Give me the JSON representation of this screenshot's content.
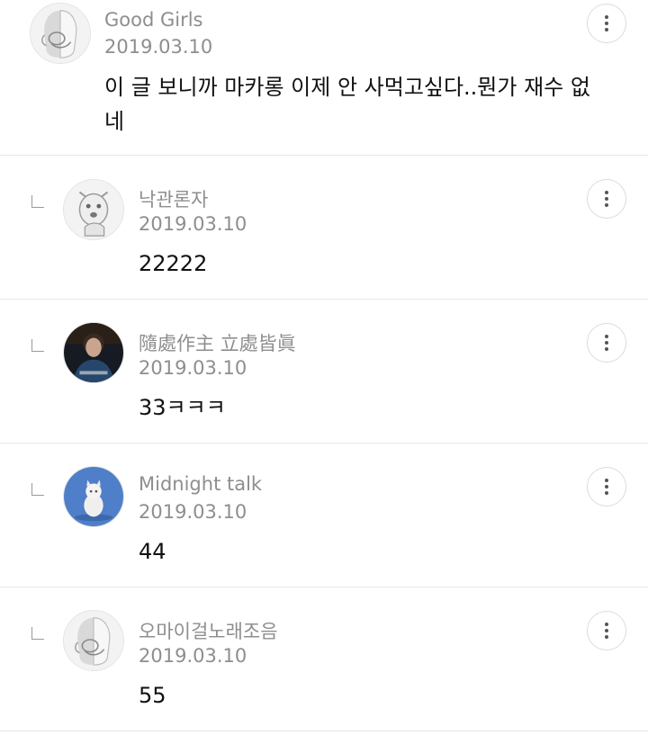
{
  "comments": [
    {
      "author": "Good Girls",
      "date": "2019.03.10",
      "text": "이 글 보니까 마카롱 이제 안 사먹고싶다..뭔가 재수 없네",
      "avatar_icon": "ghost-character-avatar-icon",
      "more_icon": "more-vert-icon"
    },
    {
      "author": "낙관론자",
      "date": "2019.03.10",
      "text": "22222",
      "avatar_icon": "dog-character-avatar-icon",
      "more_icon": "more-vert-icon"
    },
    {
      "author": "隨處作主 立處皆眞",
      "date": "2019.03.10",
      "text": "33ㅋㅋㅋ",
      "avatar_icon": "photo-avatar-icon",
      "more_icon": "more-vert-icon"
    },
    {
      "author": "Midnight talk",
      "date": "2019.03.10",
      "text": "44",
      "avatar_icon": "cat-photo-avatar-icon",
      "more_icon": "more-vert-icon"
    },
    {
      "author": "오마이걸노래조음",
      "date": "2019.03.10",
      "text": "55",
      "avatar_icon": "ghost-character-avatar-icon",
      "more_icon": "more-vert-icon"
    }
  ],
  "colors": {
    "meta_text": "#8e8e8e",
    "body_text": "#111111",
    "divider": "#e6e6e6",
    "button_border": "#dcdcdc"
  }
}
